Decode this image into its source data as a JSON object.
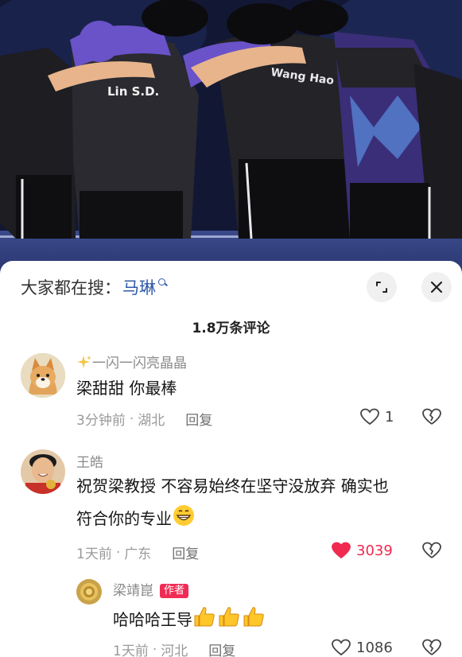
{
  "header": {
    "search_prefix": "大家都在搜：",
    "search_term": "马琳",
    "icons": {
      "search": "search-icon",
      "expand": "expand-icon",
      "close": "close-icon"
    }
  },
  "comments_count": "1.8万条评论",
  "comments": [
    {
      "username": "一闪一闪亮晶晶",
      "username_icon": "sparkles-emoji",
      "text": "梁甜甜 你最棒",
      "time": "3分钟前",
      "location": "湖北",
      "reply_label": "回复",
      "likes": "1",
      "liked": false
    },
    {
      "username": "王皓",
      "text_line1": "祝贺梁教授 不容易始终在坚守没放弃 确实也",
      "text_line2": "符合你的专业",
      "text_emoji": "grinning-face-emoji",
      "time": "1天前",
      "location": "广东",
      "reply_label": "回复",
      "likes": "3039",
      "liked": true
    },
    {
      "username": "梁靖崑",
      "badge": "作者",
      "text": "哈哈哈王导",
      "text_emoji": "thumbs-up-emoji",
      "time": "1天前",
      "location": "河北",
      "reply_label": "回复",
      "likes": "1086",
      "liked": false
    }
  ],
  "colors": {
    "link_blue": "#2f5aa8",
    "like_red": "#f0294f",
    "badge_red": "#f02c55",
    "meta_gray": "#9a9a9a"
  }
}
